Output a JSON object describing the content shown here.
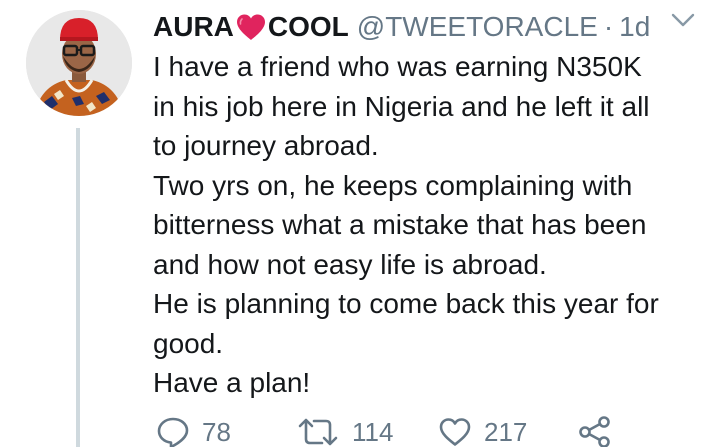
{
  "tweet": {
    "display_name_left": "AURA",
    "display_name_right": "COOL",
    "handle": "@TWEETORACLE",
    "separator": "·",
    "timestamp": "1d",
    "lines": [
      "I have a friend who was earning N350K",
      "in his job here in Nigeria and he left it all",
      "to journey abroad.",
      "Two yrs on, he keeps complaining with",
      "bitterness what a mistake that has been",
      "and how not easy life is abroad.",
      "He is planning to come back this year for",
      "good.",
      "Have a plan!"
    ],
    "actions": {
      "reply": {
        "icon": "reply-icon",
        "count": "78"
      },
      "retweet": {
        "icon": "retweet-icon",
        "count": "114"
      },
      "like": {
        "icon": "heart-outline-icon",
        "count": "217"
      },
      "share": {
        "icon": "share-icon"
      }
    }
  },
  "colors": {
    "text": "#14171a",
    "muted": "#657786",
    "heart": "#e0245e",
    "thread_line": "#cfd9de"
  }
}
